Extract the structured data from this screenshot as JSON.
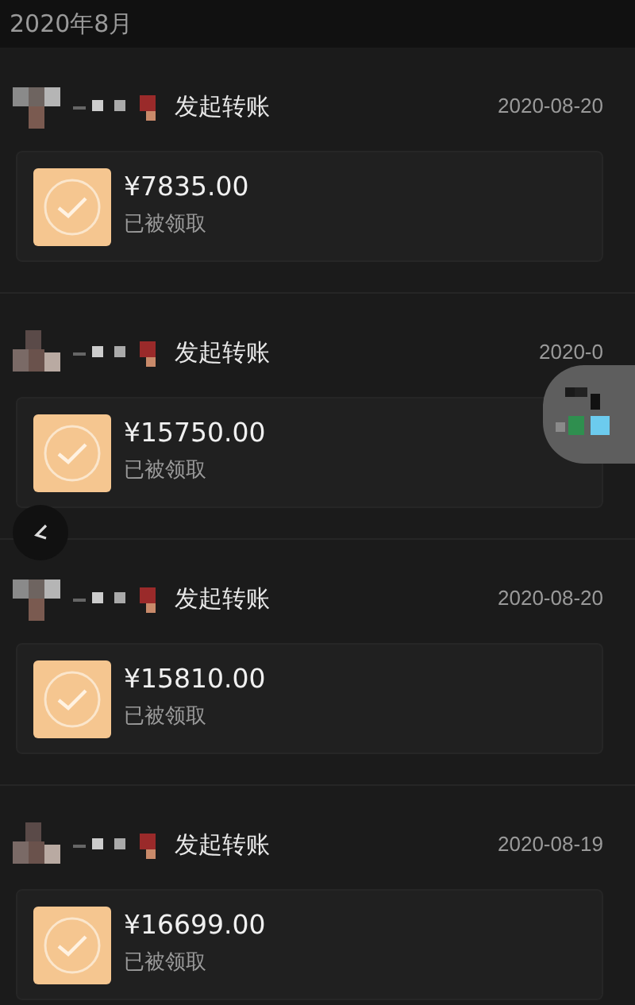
{
  "month_header": "2020年8月",
  "transfers": [
    {
      "action": "发起转账",
      "date": "2020-08-20",
      "amount": "¥7835.00",
      "status": "已被领取"
    },
    {
      "action": "发起转账",
      "date": "2020-0",
      "amount": "¥15750.00",
      "status": "已被领取"
    },
    {
      "action": "发起转账",
      "date": "2020-08-20",
      "amount": "¥15810.00",
      "status": "已被领取"
    },
    {
      "action": "发起转账",
      "date": "2020-08-19",
      "amount": "¥16699.00",
      "status": "已被领取"
    }
  ]
}
